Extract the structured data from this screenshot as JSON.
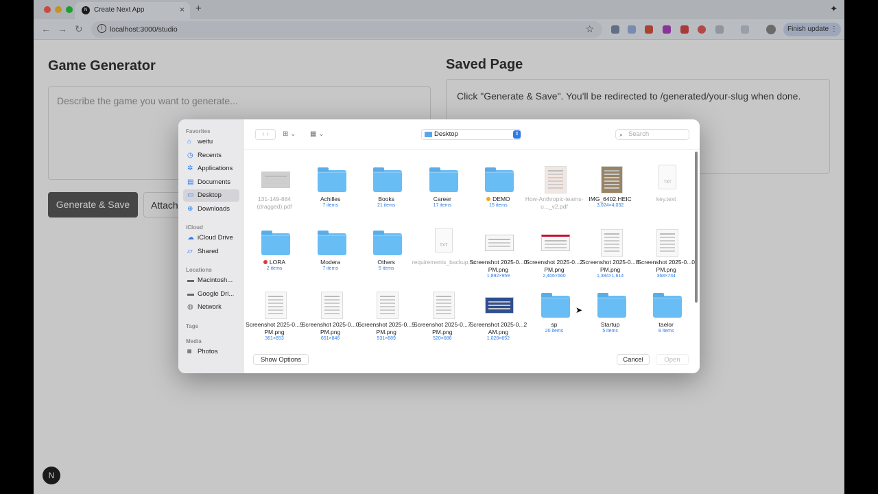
{
  "browser": {
    "tab_title": "Create Next App",
    "tab_favicon": "N",
    "url": "localhost:3000/studio",
    "finish_update_label": "Finish update",
    "traffic_colors": [
      "#ff5f57",
      "#febc2e",
      "#28c840"
    ]
  },
  "page": {
    "left_title": "Game Generator",
    "prompt_placeholder": "Describe the game you want to generate...",
    "generate_button": "Generate & Save",
    "attach_button": "Attach",
    "right_title": "Saved Page",
    "saved_hint": "Click \"Generate & Save\". You'll be redirected to /generated/your-slug when done.",
    "next_badge": "N"
  },
  "dialog": {
    "sidebar": {
      "favorites_header": "Favorites",
      "favorites": [
        {
          "label": "weitu",
          "icon": "home-icon"
        },
        {
          "label": "Recents",
          "icon": "clock-icon"
        },
        {
          "label": "Applications",
          "icon": "applications-icon"
        },
        {
          "label": "Documents",
          "icon": "document-icon"
        },
        {
          "label": "Desktop",
          "icon": "desktop-icon"
        },
        {
          "label": "Downloads",
          "icon": "download-icon"
        }
      ],
      "icloud_header": "iCloud",
      "icloud": [
        {
          "label": "iCloud Drive",
          "icon": "cloud-icon"
        },
        {
          "label": "Shared",
          "icon": "shared-folder-icon"
        }
      ],
      "locations_header": "Locations",
      "locations": [
        {
          "label": "Macintosh...",
          "icon": "disk-icon"
        },
        {
          "label": "Google Dri...",
          "icon": "disk-icon"
        },
        {
          "label": "Network",
          "icon": "globe-icon"
        }
      ],
      "tags_header": "Tags",
      "media_header": "Media",
      "media": [
        {
          "label": "Photos",
          "icon": "camera-icon"
        }
      ]
    },
    "location": "Desktop",
    "search_placeholder": "Search",
    "files": [
      {
        "name": "131-149-884 (dragged).pdf",
        "sub": "",
        "type": "pdf",
        "dim": true
      },
      {
        "name": "Achilles",
        "sub": "7 items",
        "type": "folder"
      },
      {
        "name": "Books",
        "sub": "21 items",
        "type": "folder"
      },
      {
        "name": "Career",
        "sub": "17 items",
        "type": "folder"
      },
      {
        "name": "DEMO",
        "sub": "15 items",
        "type": "folder",
        "tag": "#f5a623"
      },
      {
        "name": "How-Anthropic-teams-u..._v2.pdf",
        "sub": "",
        "type": "pdf2",
        "dim": true
      },
      {
        "name": "IMG_6402.HEIC",
        "sub": "3,024×4,032",
        "type": "photo"
      },
      {
        "name": "key.text",
        "sub": "",
        "type": "txt",
        "dim": true
      },
      {
        "name": "LORA",
        "sub": "2 items",
        "type": "folder",
        "tag": "#e0383e"
      },
      {
        "name": "Modera",
        "sub": "7 items",
        "type": "folder"
      },
      {
        "name": "Others",
        "sub": "5 items",
        "type": "folder"
      },
      {
        "name": "requirements_backup.txt",
        "sub": "",
        "type": "txt",
        "dim": true
      },
      {
        "name": "Screenshot 2025-0...0 PM.png",
        "sub": "1,892×959",
        "type": "wide"
      },
      {
        "name": "Screenshot 2025-0...2 PM.png",
        "sub": "2,406×660",
        "type": "wide-red"
      },
      {
        "name": "Screenshot 2025-0...8 PM.png",
        "sub": "1,384×1,614",
        "type": "shot"
      },
      {
        "name": "Screenshot 2025-0...0 PM.png",
        "sub": "368×734",
        "type": "shot"
      },
      {
        "name": "Screenshot 2025-0...9 PM.png",
        "sub": "361×653",
        "type": "shot"
      },
      {
        "name": "Screenshot 2025-0...0 PM.png",
        "sub": "651×846",
        "type": "shot"
      },
      {
        "name": "Screenshot 2025-0...9 PM.png",
        "sub": "531×689",
        "type": "shot"
      },
      {
        "name": "Screenshot 2025-0...7 PM.png",
        "sub": "520×686",
        "type": "shot"
      },
      {
        "name": "Screenshot 2025-0...2 AM.png",
        "sub": "1,028×652",
        "type": "photo-wide"
      },
      {
        "name": "sp",
        "sub": "20 items",
        "type": "folder"
      },
      {
        "name": "Startup",
        "sub": "5 items",
        "type": "folder"
      },
      {
        "name": "taelor",
        "sub": "8 items",
        "type": "folder"
      }
    ],
    "show_options": "Show Options",
    "cancel": "Cancel",
    "open": "Open"
  }
}
